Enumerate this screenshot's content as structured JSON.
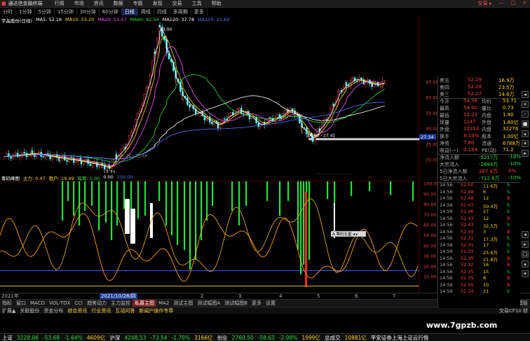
{
  "app": {
    "logo": "■",
    "title": "通达信金融终端",
    "menu": [
      "行情",
      "市场",
      "资讯",
      "数据",
      "专题",
      "发现",
      "交易",
      "工具",
      "帮助"
    ],
    "right_menu": [
      "交易 ▸",
      "—",
      "□",
      "×"
    ]
  },
  "periods": [
    "分时",
    "1分钟",
    "5分钟",
    "15分钟",
    "30分钟",
    "60分钟",
    "日线",
    "周线",
    "月线",
    "多周期",
    "更多"
  ],
  "active_period": "日线",
  "ma_legend": {
    "stock": "宇晶股份(日线)",
    "items": [
      {
        "label": "MA5: 52.16",
        "color": "#ffffff"
      },
      {
        "label": "MA10: 53.20",
        "color": "#ffd700"
      },
      {
        "label": "MA20: 51.57",
        "color": "#ff55ff"
      },
      {
        "label": "MA60: 42.54",
        "color": "#23e23c"
      },
      {
        "label": "MA120: 37.78",
        "color": "#ffffff"
      },
      {
        "label": "MA250: 31.69",
        "color": "#4477ff"
      }
    ]
  },
  "ind_legend": {
    "name": "筹码峰图",
    "items": [
      {
        "label": "主力: 0.47",
        "color": "#ffd700"
      },
      {
        "label": "散户: 19.49",
        "color": "#ffd700"
      },
      {
        "label": "吸筹: 0.00",
        "color": "#23e23c"
      },
      {
        "label": "0.00",
        "color": "#ffffff"
      },
      {
        "label": "100.00",
        "color": "#4477ff"
      }
    ]
  },
  "price_axis": [
    "45.00",
    "40.00",
    "35.00",
    "30.00",
    "25.00",
    "20.00"
  ],
  "current_price_tag": "27.34",
  "annotations": {
    "high": "63.00",
    "low": "17.33",
    "range1": "26.60 - 27.41",
    "range2": "21.46 - 23.66"
  },
  "ind_axis": [
    "100.00",
    "90.00",
    "80.00",
    "70.00",
    "60.00",
    "50.00",
    "40.00",
    "30.00",
    "20.00",
    "10.00"
  ],
  "ind_buttons": [
    "A 筹码五星 ◂ ▸",
    "A 筹码五星 ◂ ▸"
  ],
  "quote": {
    "asks": [
      {
        "label": "卖五",
        "price": "52.29",
        "vol": "16.9万"
      },
      {
        "label": "卖四",
        "price": "52.28",
        "vol": "23.5万"
      },
      {
        "label": "卖三",
        "price": "52.27",
        "vol": "14.6万"
      }
    ],
    "fields": [
      {
        "l1": "今开",
        "v1": "54.36",
        "l2": "均价",
        "v2": "53.71"
      },
      {
        "l1": "最高",
        "v1": "54.40",
        "l2": "量比",
        "v2": "0.73"
      },
      {
        "l1": "最低",
        "v1": "52.23",
        "l2": "内盘",
        "v2": "1.90"
      },
      {
        "l1": "现量",
        "v1": "1147",
        "l2": "外盘",
        "v2": "1.80亿"
      },
      {
        "l1": "外盘",
        "v1": "22313",
        "l2": "内盘",
        "v2": "32276"
      },
      {
        "l1": "换手",
        "v1": "8.14%",
        "l2": "股本",
        "v2": "1.00亿"
      },
      {
        "l1": "净资",
        "v1": "7.80",
        "l2": "流通",
        "v2": "6788万"
      },
      {
        "l1": "收益(一)",
        "v1": "0.184",
        "l2": "PE(动)",
        "v2": "71.2"
      }
    ],
    "flows": [
      {
        "label": "净流入额",
        "value": "-5217万",
        "pct": "-18%"
      },
      {
        "label": "大宗流入",
        "value": "-2844万",
        "pct": "-10%"
      },
      {
        "label": "5日净流入额",
        "value": "267.4万",
        "pct": "0%"
      },
      {
        "label": "5日大宗流入",
        "value": "-712.6万",
        "pct": "-10%"
      }
    ],
    "ticks": [
      {
        "time": "14:56",
        "price": "52.50",
        "vol": "11.6万",
        "dir": "S"
      },
      {
        "time": "14:56",
        "price": "52.48",
        "vol": "6",
        "dir": "S"
      },
      {
        "time": "14:56",
        "price": "52.48",
        "vol": "12",
        "dir": "B"
      },
      {
        "time": "14:56",
        "price": "52.47",
        "vol": "50.4万",
        "dir": "S"
      },
      {
        "time": "14:56",
        "price": "52.46",
        "vol": "27",
        "dir": "S"
      },
      {
        "time": "14:56",
        "price": "52.43",
        "vol": "12",
        "dir": "B"
      },
      {
        "time": "14:56",
        "price": "52.43",
        "vol": "32.5万",
        "dir": "S"
      },
      {
        "time": "14:56",
        "price": "52.39",
        "vol": "3",
        "dir": "B"
      },
      {
        "time": "14:56",
        "price": "52.31",
        "vol": "17.3万",
        "dir": "S"
      },
      {
        "time": "14:56",
        "price": "52.31",
        "vol": "17",
        "dir": "S"
      },
      {
        "time": "14:56",
        "price": "52.31",
        "vol": "25.6万",
        "dir": "S"
      },
      {
        "time": "14:56",
        "price": "52.35",
        "vol": "21.8万",
        "dir": "B"
      },
      {
        "time": "14:56",
        "price": "52.32",
        "vol": "16",
        "dir": "B"
      },
      {
        "time": "14:56",
        "price": "52.35",
        "vol": "15",
        "dir": "S"
      },
      {
        "time": "14:56",
        "price": "52.35",
        "vol": "8",
        "dir": "B"
      },
      {
        "time": "14:56",
        "price": "52.35",
        "vol": "10",
        "dir": "B"
      },
      {
        "time": "14:56",
        "price": "52.34",
        "vol": "21",
        "dir": "S"
      }
    ],
    "detail_label": "笔",
    "sell_label": "卖",
    "buy_label": "买"
  },
  "dates": [
    {
      "label": "2021年"
    },
    {
      "label": "2021/10/28/四"
    },
    {
      "label": "2"
    },
    {
      "label": "3"
    },
    {
      "label": "4"
    },
    {
      "label": "5"
    },
    {
      "label": "6"
    },
    {
      "label": "7"
    }
  ],
  "tabs": [
    "指标",
    "窗口",
    "MACD",
    "VOL-TDX",
    "CCI",
    "趋势动力",
    "主力监控",
    "私募主图",
    "MA2",
    "测试主图",
    "测试幅图A",
    "测试幅图B",
    "更多",
    "设置"
  ],
  "active_tab": "私募主图",
  "tab_right": "模板",
  "infobar": [
    "扩展▲",
    "关联股份",
    "资金分布",
    "综合资讯",
    "行业资讯",
    "互动问答",
    "新闻户操作专章"
  ],
  "infobar_right": "交易CF10 财",
  "indexes": [
    {
      "name": "上证",
      "value": "3228.06",
      "chg": "-53.68",
      "pct": "-1.64%",
      "amt": "4609亿"
    },
    {
      "name": "沪深",
      "value": "4248.53",
      "chg": "-73.54",
      "pct": "-1.70%",
      "amt": "3166亿"
    },
    {
      "name": "创业",
      "value": "2760.50",
      "chg": "-58.63",
      "pct": "-2.08%",
      "amt": "1999亿"
    }
  ],
  "total_label": "总成交",
  "total_value": "10881亿",
  "broker": "平安证券上海上证云行情",
  "watermark": "www.7gpzb.com",
  "side_buttons": [
    "◂",
    "+",
    "-",
    "■",
    "▴",
    "▾",
    "▸",
    "◂",
    "▸",
    "□",
    "▴",
    "▾"
  ]
}
